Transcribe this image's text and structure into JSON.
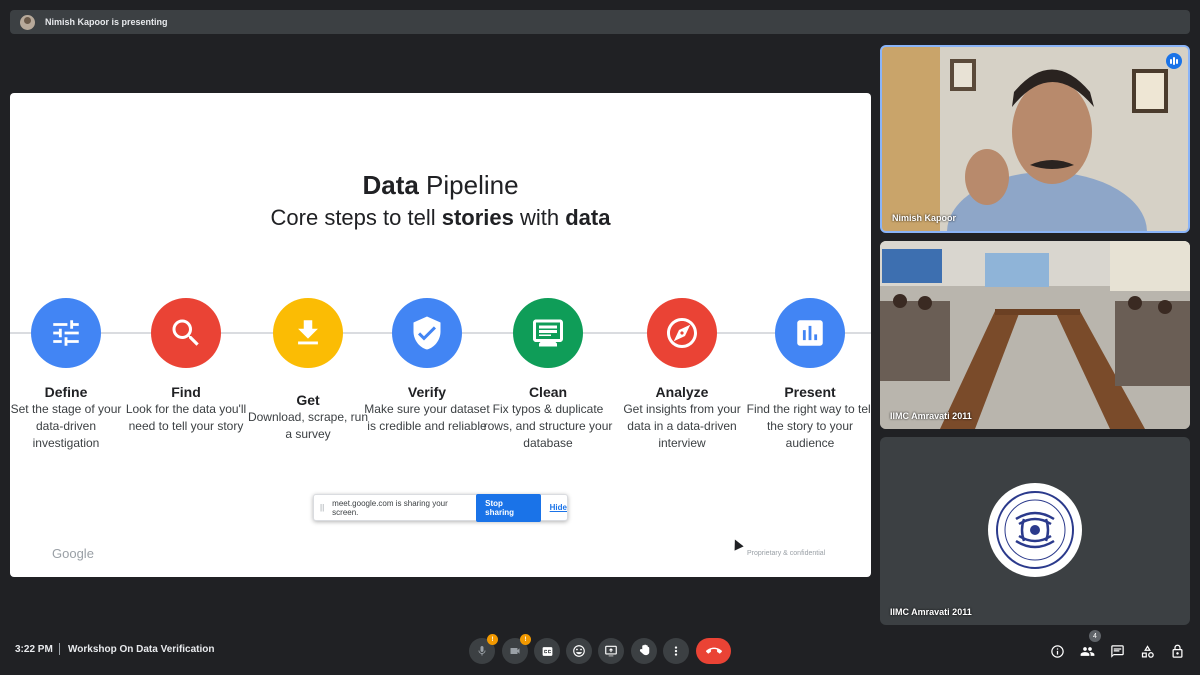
{
  "presenting_banner": "Nimish Kapoor is presenting",
  "slide": {
    "title_bold": "Data",
    "title_rest": " Pipeline",
    "subtitle_a": "Core steps to tell ",
    "subtitle_b": "stories",
    "subtitle_c": " with ",
    "subtitle_d": "data",
    "steps": [
      {
        "name": "Define",
        "desc": "Set the stage of your data-driven investigation",
        "icon": "sliders-icon",
        "color": "#4285f4"
      },
      {
        "name": "Find",
        "desc": "Look for the data you'll need to tell your story",
        "icon": "search-icon",
        "color": "#ea4335"
      },
      {
        "name": "Get",
        "desc": "Download, scrape, run a survey",
        "icon": "download-icon",
        "color": "#fbbc04"
      },
      {
        "name": "Verify",
        "desc": "Make sure your dataset is credible and reliable",
        "icon": "shield-check-icon",
        "color": "#4285f4"
      },
      {
        "name": "Clean",
        "desc": "Fix typos & duplicate rows, and structure your database",
        "icon": "list-icon",
        "color": "#0f9d58"
      },
      {
        "name": "Analyze",
        "desc": "Get insights from your data in a data-driven interview",
        "icon": "compass-icon",
        "color": "#ea4335"
      },
      {
        "name": "Present",
        "desc": "Find the right way to tell the story to your audience",
        "icon": "bar-chart-icon",
        "color": "#4285f4"
      }
    ],
    "footer_logo": "Google",
    "footer_note": "Proprietary & confidential"
  },
  "share_bar": {
    "grip": "||",
    "text": "meet.google.com is sharing your screen.",
    "stop_label": "Stop sharing",
    "hide_label": "Hide"
  },
  "participants": [
    {
      "name": "Nimish Kapoor"
    },
    {
      "name": "IIMC Amravati 2011"
    },
    {
      "name": "IIMC Amravati 2011"
    }
  ],
  "bottom": {
    "time": "3:22 PM",
    "meeting_title": "Workshop On Data Verification",
    "mic_badge": "!",
    "cam_badge": "!",
    "people_count": "4"
  }
}
